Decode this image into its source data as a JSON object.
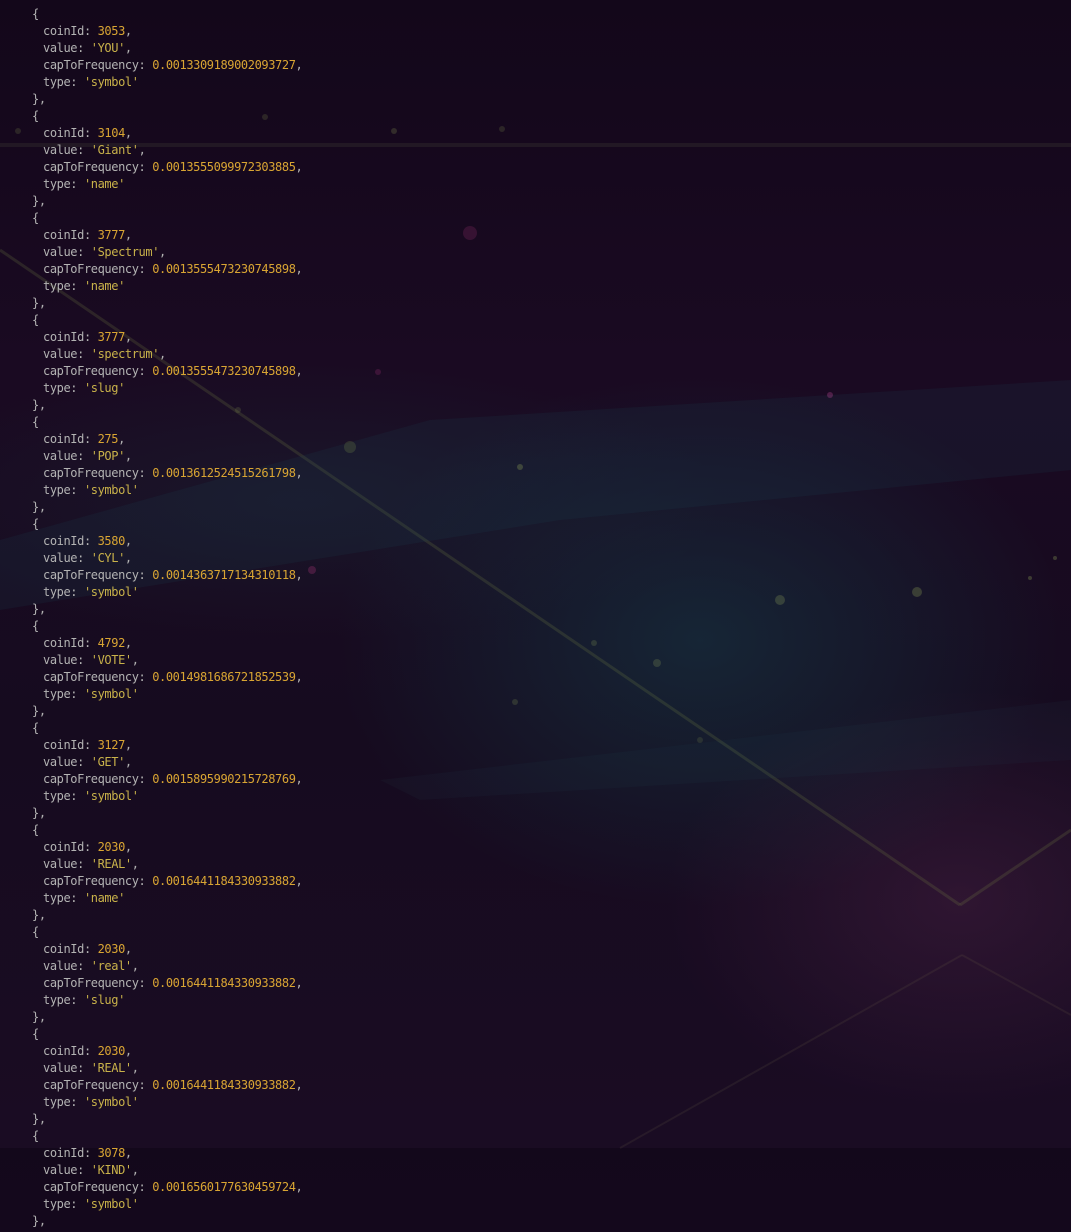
{
  "colors": {
    "background": "#150919",
    "key": "#b3b3b3",
    "number": "#d9a533",
    "string": "#c9b24a"
  },
  "records": [
    {
      "coinId": "3053",
      "value": "'YOU'",
      "capToFrequency": "0.0013309189002093727",
      "type": "'symbol'"
    },
    {
      "coinId": "3104",
      "value": "'Giant'",
      "capToFrequency": "0.0013555099972303885",
      "type": "'name'"
    },
    {
      "coinId": "3777",
      "value": "'Spectrum'",
      "capToFrequency": "0.0013555473230745898",
      "type": "'name'"
    },
    {
      "coinId": "3777",
      "value": "'spectrum'",
      "capToFrequency": "0.0013555473230745898",
      "type": "'slug'"
    },
    {
      "coinId": "275",
      "value": "'POP'",
      "capToFrequency": "0.0013612524515261798",
      "type": "'symbol'"
    },
    {
      "coinId": "3580",
      "value": "'CYL'",
      "capToFrequency": "0.0014363717134310118",
      "type": "'symbol'"
    },
    {
      "coinId": "4792",
      "value": "'VOTE'",
      "capToFrequency": "0.0014981686721852539",
      "type": "'symbol'"
    },
    {
      "coinId": "3127",
      "value": "'GET'",
      "capToFrequency": "0.0015895990215728769",
      "type": "'symbol'"
    },
    {
      "coinId": "2030",
      "value": "'REAL'",
      "capToFrequency": "0.0016441184330933882",
      "type": "'name'"
    },
    {
      "coinId": "2030",
      "value": "'real'",
      "capToFrequency": "0.0016441184330933882",
      "type": "'slug'"
    },
    {
      "coinId": "2030",
      "value": "'REAL'",
      "capToFrequency": "0.0016441184330933882",
      "type": "'symbol'"
    },
    {
      "coinId": "3078",
      "value": "'KIND'",
      "capToFrequency": "0.0016560177630459724",
      "type": "'symbol'"
    }
  ],
  "labels": {
    "open_brace": "{",
    "close_brace": "},",
    "key_coinId": "coinId: ",
    "key_value": "value: ",
    "key_capToFrequency": "capToFrequency: ",
    "key_type": "type: ",
    "comma": ","
  }
}
